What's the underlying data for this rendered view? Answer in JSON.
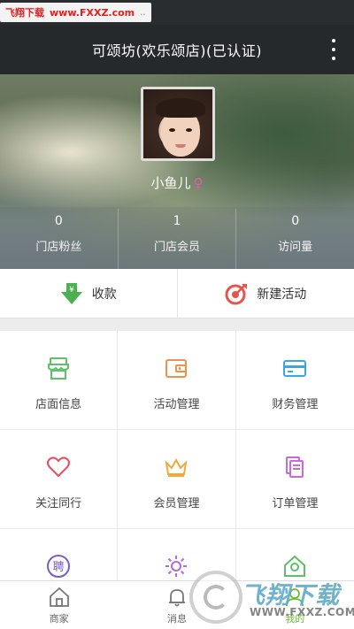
{
  "watermark": {
    "site_label": "飞翔下载",
    "url": "www.FXXZ.com",
    "dots": "..",
    "brand": "飞翔下载",
    "brand_url": "WWW.FXXZ.COM"
  },
  "header": {
    "title": "可颂坊(欢乐颂店)(已认证)"
  },
  "profile": {
    "username": "小鱼儿",
    "gender_symbol": "♀",
    "stats": [
      {
        "value": "0",
        "label": "门店粉丝"
      },
      {
        "value": "1",
        "label": "门店会员"
      },
      {
        "value": "0",
        "label": "访问量"
      }
    ]
  },
  "actions": [
    {
      "label": "收款",
      "icon": "download-yuan-icon",
      "color": "#4caf50"
    },
    {
      "label": "新建活动",
      "icon": "target-icon",
      "color": "#e8534e"
    }
  ],
  "menu": [
    {
      "label": "店面信息",
      "icon": "store-icon",
      "color": "#5cc169"
    },
    {
      "label": "活动管理",
      "icon": "wallet-icon",
      "color": "#f0914a"
    },
    {
      "label": "财务管理",
      "icon": "card-icon",
      "color": "#3aa7e0"
    },
    {
      "label": "关注同行",
      "icon": "heart-icon",
      "color": "#e84c5f"
    },
    {
      "label": "会员管理",
      "icon": "crown-icon",
      "color": "#f0a93a"
    },
    {
      "label": "订单管理",
      "icon": "document-icon",
      "color": "#c86bd6"
    },
    {
      "label": "",
      "icon": "recruit-icon",
      "glyph": "聘",
      "color": "#7a5cc8"
    },
    {
      "label": "",
      "icon": "sun-icon",
      "color": "#b46bd8"
    },
    {
      "label": "",
      "icon": "shop-house-icon",
      "color": "#5cc169"
    }
  ],
  "bottom_nav": [
    {
      "label": "商家",
      "icon": "home-icon",
      "active": false
    },
    {
      "label": "消息",
      "icon": "bell-icon",
      "active": false
    },
    {
      "label": "我的",
      "icon": "person-icon",
      "active": true
    }
  ]
}
